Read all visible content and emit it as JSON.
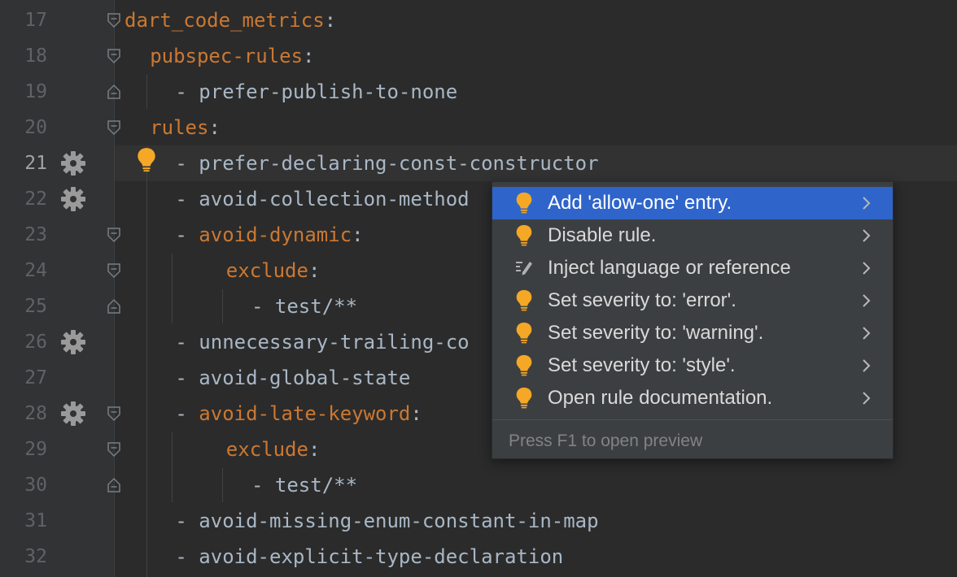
{
  "editor": {
    "lines": [
      {
        "n": "17",
        "indent": "",
        "dash": "",
        "text": "dart_code_metrics",
        "key": true,
        "colon": true,
        "gear": false,
        "fold": "open"
      },
      {
        "n": "18",
        "indent": "  ",
        "dash": "",
        "text": "pubspec-rules",
        "key": true,
        "colon": true,
        "gear": false,
        "fold": "open"
      },
      {
        "n": "19",
        "indent": "    ",
        "dash": "- ",
        "text": "prefer-publish-to-none",
        "key": false,
        "colon": false,
        "gear": false,
        "fold": "close"
      },
      {
        "n": "20",
        "indent": "  ",
        "dash": "",
        "text": "rules",
        "key": true,
        "colon": true,
        "gear": false,
        "fold": "open"
      },
      {
        "n": "21",
        "indent": "    ",
        "dash": "- ",
        "text": "prefer-declaring-const-constructor",
        "key": false,
        "colon": false,
        "gear": true,
        "fold": "",
        "active": true,
        "bulb": true
      },
      {
        "n": "22",
        "indent": "    ",
        "dash": "- ",
        "text": "avoid-collection-method",
        "key": false,
        "colon": false,
        "gear": true,
        "fold": ""
      },
      {
        "n": "23",
        "indent": "    ",
        "dash": "- ",
        "text": "avoid-dynamic",
        "key": true,
        "colon": true,
        "gear": false,
        "fold": "open"
      },
      {
        "n": "24",
        "indent": "        ",
        "dash": "",
        "text": "exclude",
        "key": true,
        "colon": true,
        "gear": false,
        "fold": "open"
      },
      {
        "n": "25",
        "indent": "          ",
        "dash": "- ",
        "text": "test/**",
        "key": false,
        "colon": false,
        "gear": false,
        "fold": "close"
      },
      {
        "n": "26",
        "indent": "    ",
        "dash": "- ",
        "text": "unnecessary-trailing-co",
        "key": false,
        "colon": false,
        "gear": true,
        "fold": ""
      },
      {
        "n": "27",
        "indent": "    ",
        "dash": "- ",
        "text": "avoid-global-state",
        "key": false,
        "colon": false,
        "gear": false,
        "fold": ""
      },
      {
        "n": "28",
        "indent": "    ",
        "dash": "- ",
        "text": "avoid-late-keyword",
        "key": true,
        "colon": true,
        "gear": true,
        "fold": "open"
      },
      {
        "n": "29",
        "indent": "        ",
        "dash": "",
        "text": "exclude",
        "key": true,
        "colon": true,
        "gear": false,
        "fold": "open"
      },
      {
        "n": "30",
        "indent": "          ",
        "dash": "- ",
        "text": "test/**",
        "key": false,
        "colon": false,
        "gear": false,
        "fold": "close"
      },
      {
        "n": "31",
        "indent": "    ",
        "dash": "- ",
        "text": "avoid-missing-enum-constant-in-map",
        "key": false,
        "colon": false,
        "gear": false,
        "fold": ""
      },
      {
        "n": "32",
        "indent": "    ",
        "dash": "- ",
        "text": "avoid-explicit-type-declaration",
        "key": false,
        "colon": false,
        "gear": false,
        "fold": ""
      }
    ],
    "colors": {
      "key": "#cc7832",
      "text": "#a9b7c6",
      "background": "#2b2b2b",
      "gutter": "#313335"
    }
  },
  "popup": {
    "items": [
      {
        "label": "Add 'allow-one' entry.",
        "icon": "bulb-icon",
        "selected": true
      },
      {
        "label": "Disable rule.",
        "icon": "bulb-icon",
        "selected": false
      },
      {
        "label": "Inject language or reference",
        "icon": "edit-pen-icon",
        "selected": false
      },
      {
        "label": "Set severity to: 'error'.",
        "icon": "bulb-icon",
        "selected": false
      },
      {
        "label": "Set severity to: 'warning'.",
        "icon": "bulb-icon",
        "selected": false
      },
      {
        "label": "Set severity to: 'style'.",
        "icon": "bulb-icon",
        "selected": false
      },
      {
        "label": "Open rule documentation.",
        "icon": "bulb-icon",
        "selected": false
      }
    ],
    "hint": "Press F1 to open preview",
    "colors": {
      "selected": "#2f65ca",
      "bulb": "#f4a825"
    }
  }
}
